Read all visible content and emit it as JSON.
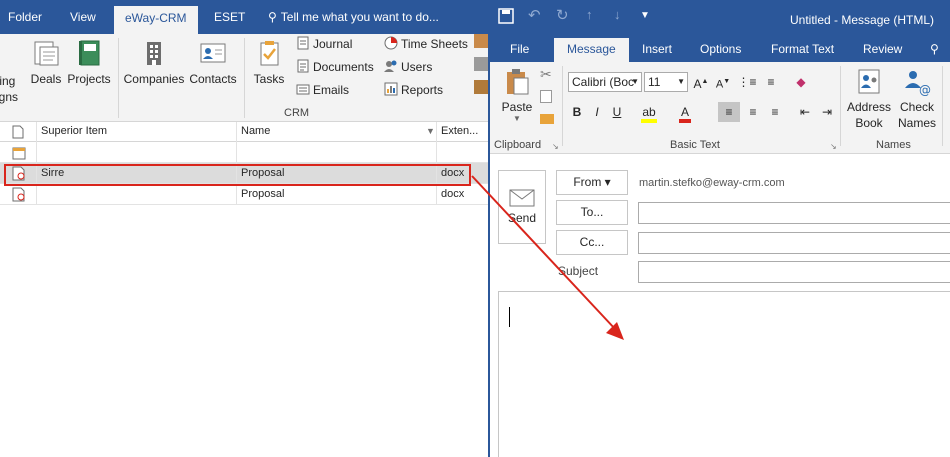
{
  "outlook": {
    "tabs": [
      "Folder",
      "View",
      "eWay-CRM",
      "ESET"
    ],
    "active_tab": "eWay-CRM",
    "tell_me": "Tell me what you want to do...",
    "ribbon": {
      "cut_off_left_1": "ting",
      "cut_off_left_2": "igns",
      "deals": "Deals",
      "projects": "Projects",
      "companies": "Companies",
      "contacts": "Contacts",
      "tasks": "Tasks",
      "journal": "Journal",
      "documents": "Documents",
      "emails": "Emails",
      "time_sheets": "Time Sheets",
      "users": "Users",
      "reports": "Reports",
      "group_label": "CRM"
    },
    "grid": {
      "columns": [
        "Superior Item",
        "Name",
        "Exten..."
      ],
      "rows": [
        {
          "superior": "",
          "name": "",
          "ext": ""
        },
        {
          "superior": "Sirre",
          "name": "Proposal",
          "ext": "docx"
        },
        {
          "superior": "",
          "name": "Proposal",
          "ext": "docx"
        }
      ]
    }
  },
  "message": {
    "title": "Untitled - Message (HTML)",
    "tabs": [
      "File",
      "Message",
      "Insert",
      "Options",
      "Format Text",
      "Review"
    ],
    "active_tab": "Message",
    "ribbon": {
      "paste": "Paste",
      "clipboard": "Clipboard",
      "font_name": "Calibri (Boc",
      "font_size": "11",
      "basic_text": "Basic Text",
      "address_book_1": "Address",
      "address_book_2": "Book",
      "check_names_1": "Check",
      "check_names_2": "Names",
      "names": "Names"
    },
    "compose": {
      "send": "Send",
      "from_label": "From ▾",
      "from_value": "martin.stefko@eway-crm.com",
      "to_label": "To...",
      "cc_label": "Cc...",
      "subject_label": "Subject"
    }
  },
  "colors": {
    "brand_blue": "#2b579a",
    "highlight_red": "#d9251c"
  }
}
